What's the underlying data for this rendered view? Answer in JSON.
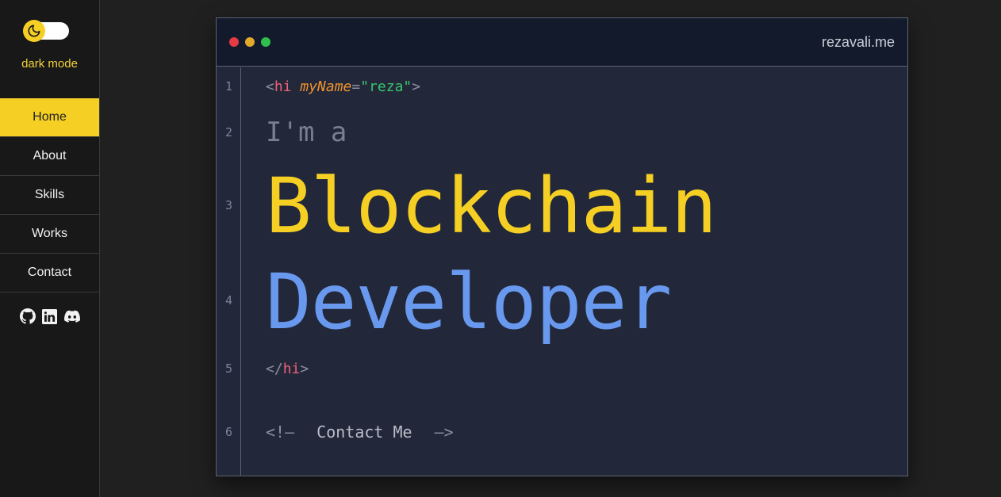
{
  "sidebar": {
    "mode_label": "dark mode",
    "nav": [
      {
        "label": "Home",
        "active": true
      },
      {
        "label": "About",
        "active": false
      },
      {
        "label": "Skills",
        "active": false
      },
      {
        "label": "Works",
        "active": false
      },
      {
        "label": "Contact",
        "active": false
      }
    ],
    "socials": [
      "github-icon",
      "linkedin-icon",
      "discord-icon"
    ]
  },
  "window": {
    "title": "rezavali.me",
    "dot_colors": [
      "#e63b45",
      "#e3a92a",
      "#2fbf4d"
    ],
    "line_numbers": [
      "1",
      "2",
      "3",
      "4",
      "5",
      "6"
    ],
    "line1": {
      "open": "<",
      "tag": "hi",
      "attr": "myName",
      "eq": "=",
      "value": "\"reza\"",
      "close": ">"
    },
    "line2": "I'm a",
    "line3": "Blockchain",
    "line4": "Developer",
    "line5": {
      "open": "</",
      "tag": "hi",
      "close": ">"
    },
    "line6": {
      "prefix": "<!—",
      "text": "Contact Me",
      "suffix": "—>"
    }
  },
  "colors": {
    "accent_yellow": "#f5cf24",
    "accent_blue": "#6999ef",
    "tag_red": "#f0607a",
    "attr_orange": "#f0922f",
    "string_green": "#39c46b"
  }
}
